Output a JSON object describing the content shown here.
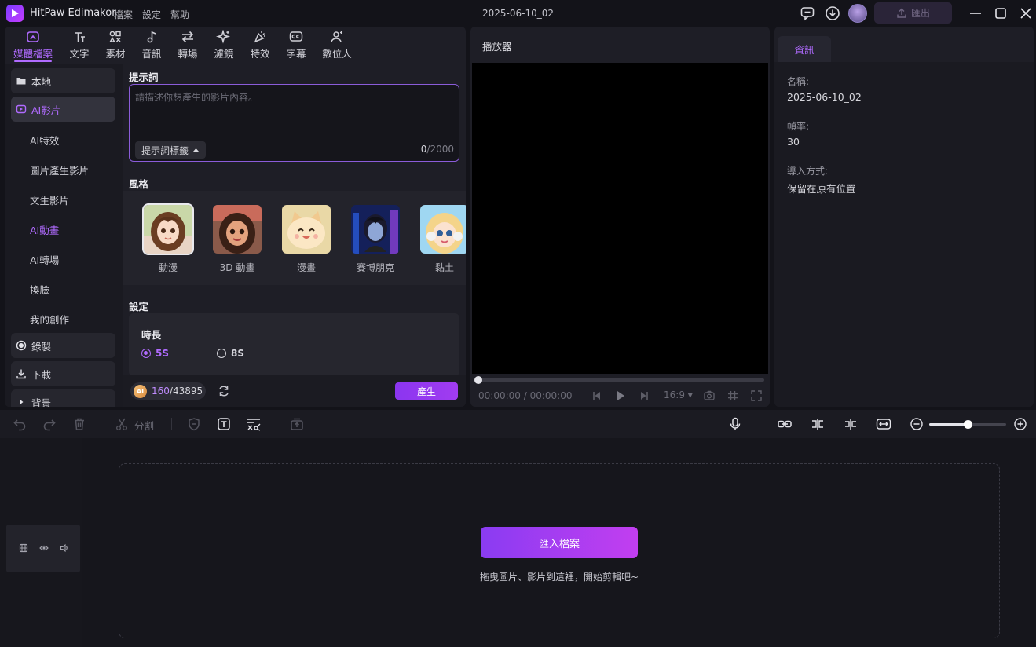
{
  "app": {
    "name": "HitPaw Edimakor",
    "project_title": "2025-06-10_02",
    "menu": [
      "檔案",
      "設定",
      "幫助"
    ],
    "export_label": "匯出"
  },
  "category_tabs": [
    {
      "label": "媒體檔案",
      "icon": "media-icon",
      "active": true
    },
    {
      "label": "文字",
      "icon": "text-icon"
    },
    {
      "label": "素材",
      "icon": "elements-icon"
    },
    {
      "label": "音訊",
      "icon": "audio-icon"
    },
    {
      "label": "轉場",
      "icon": "transition-icon"
    },
    {
      "label": "濾鏡",
      "icon": "filter-icon"
    },
    {
      "label": "特效",
      "icon": "effects-icon"
    },
    {
      "label": "字幕",
      "icon": "subtitle-icon"
    },
    {
      "label": "數位人",
      "icon": "avatar-icon"
    }
  ],
  "sidebar": {
    "groups": [
      {
        "label": "本地",
        "icon": "folder-icon"
      },
      {
        "label": "AI影片",
        "icon": "ai-video-icon",
        "active": true
      },
      {
        "label": "錄製",
        "icon": "record-icon"
      },
      {
        "label": "下載",
        "icon": "download-icon"
      },
      {
        "label": "背景",
        "icon": "caret-right-icon"
      }
    ],
    "sub_items": [
      "AI特效",
      "圖片產生影片",
      "文生影片",
      "AI動畫",
      "AI轉場",
      "換臉",
      "我的創作"
    ],
    "active_sub": "AI動畫"
  },
  "prompt": {
    "title": "提示詞",
    "placeholder": "請描述你想產生的影片內容。",
    "tag_button": "提示詞標籤",
    "count_used": "0",
    "count_max": "/2000"
  },
  "styles": {
    "title": "風格",
    "items": [
      {
        "label": "動漫",
        "selected": true
      },
      {
        "label": "3D 動畫"
      },
      {
        "label": "漫畫"
      },
      {
        "label": "賽博朋克"
      },
      {
        "label": "黏土"
      }
    ]
  },
  "settings": {
    "title": "設定",
    "duration_label": "時長",
    "options": [
      "5S",
      "8S"
    ],
    "selected": "5S"
  },
  "credits": {
    "coin_label": "AI",
    "used": "160",
    "total": "/43895"
  },
  "generate_label": "產生",
  "player": {
    "title": "播放器",
    "time_current": "00:00:00",
    "time_separator": " / ",
    "time_total": "00:00:00",
    "aspect_ratio": "16:9",
    "progress": 0
  },
  "info": {
    "tab_label": "資訊",
    "fields": [
      {
        "label": "名稱:",
        "value": "2025-06-10_02"
      },
      {
        "label": "幀率:",
        "value": "30"
      },
      {
        "label": "導入方式:",
        "value": "保留在原有位置"
      }
    ]
  },
  "timeline": {
    "split_label": "分割",
    "zoom_level": 0.5,
    "import_label": "匯入檔案",
    "drop_hint": "拖曳圖片、影片到這裡，開始剪輯吧~"
  },
  "colors": {
    "accent": "#b06bff",
    "button_gradient_start": "#8a3cf2",
    "button_gradient_end": "#c23ef0",
    "background": "#131319",
    "panel": "#1e1e26"
  }
}
